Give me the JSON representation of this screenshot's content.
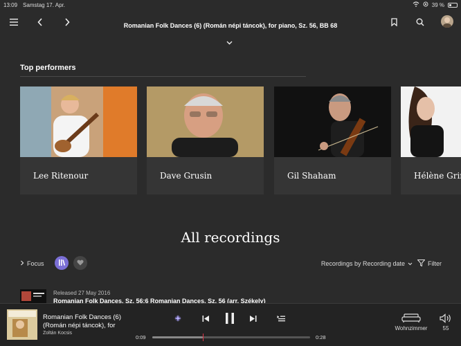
{
  "status": {
    "time": "13:09",
    "date": "Samstag 17. Apr.",
    "battery": "39 %",
    "battery_level": 0.39
  },
  "header": {
    "title": "Romanian Folk Dances (6) (Román népi táncok), for piano, Sz. 56, BB 68"
  },
  "top_performers": {
    "title": "Top performers",
    "items": [
      {
        "name": "Lee Ritenour"
      },
      {
        "name": "Dave Grusin"
      },
      {
        "name": "Gil Shaham"
      },
      {
        "name": "Hélène Grimaud"
      }
    ]
  },
  "recordings": {
    "title": "All recordings",
    "focus_label": "Focus",
    "sort_label": "Recordings by Recording date",
    "filter_label": "Filter",
    "items": [
      {
        "date": "Released 27 May 2016",
        "title": "Romanian Folk Dances, Sz. 56:6 Romanian Dances, Sz. 56 (arr. Székely)"
      }
    ]
  },
  "player": {
    "title": "Romanian Folk Dances (6) (Román népi táncok), for",
    "artist": "Zoltán Kocsis",
    "elapsed": "0:09",
    "total": "0:28",
    "progress": 0.32,
    "device": "Wohnzimmer",
    "volume": "55"
  },
  "colors": {
    "accent": "#7b6fd6",
    "background": "#2b2b2b",
    "marker": "#e0384a"
  }
}
